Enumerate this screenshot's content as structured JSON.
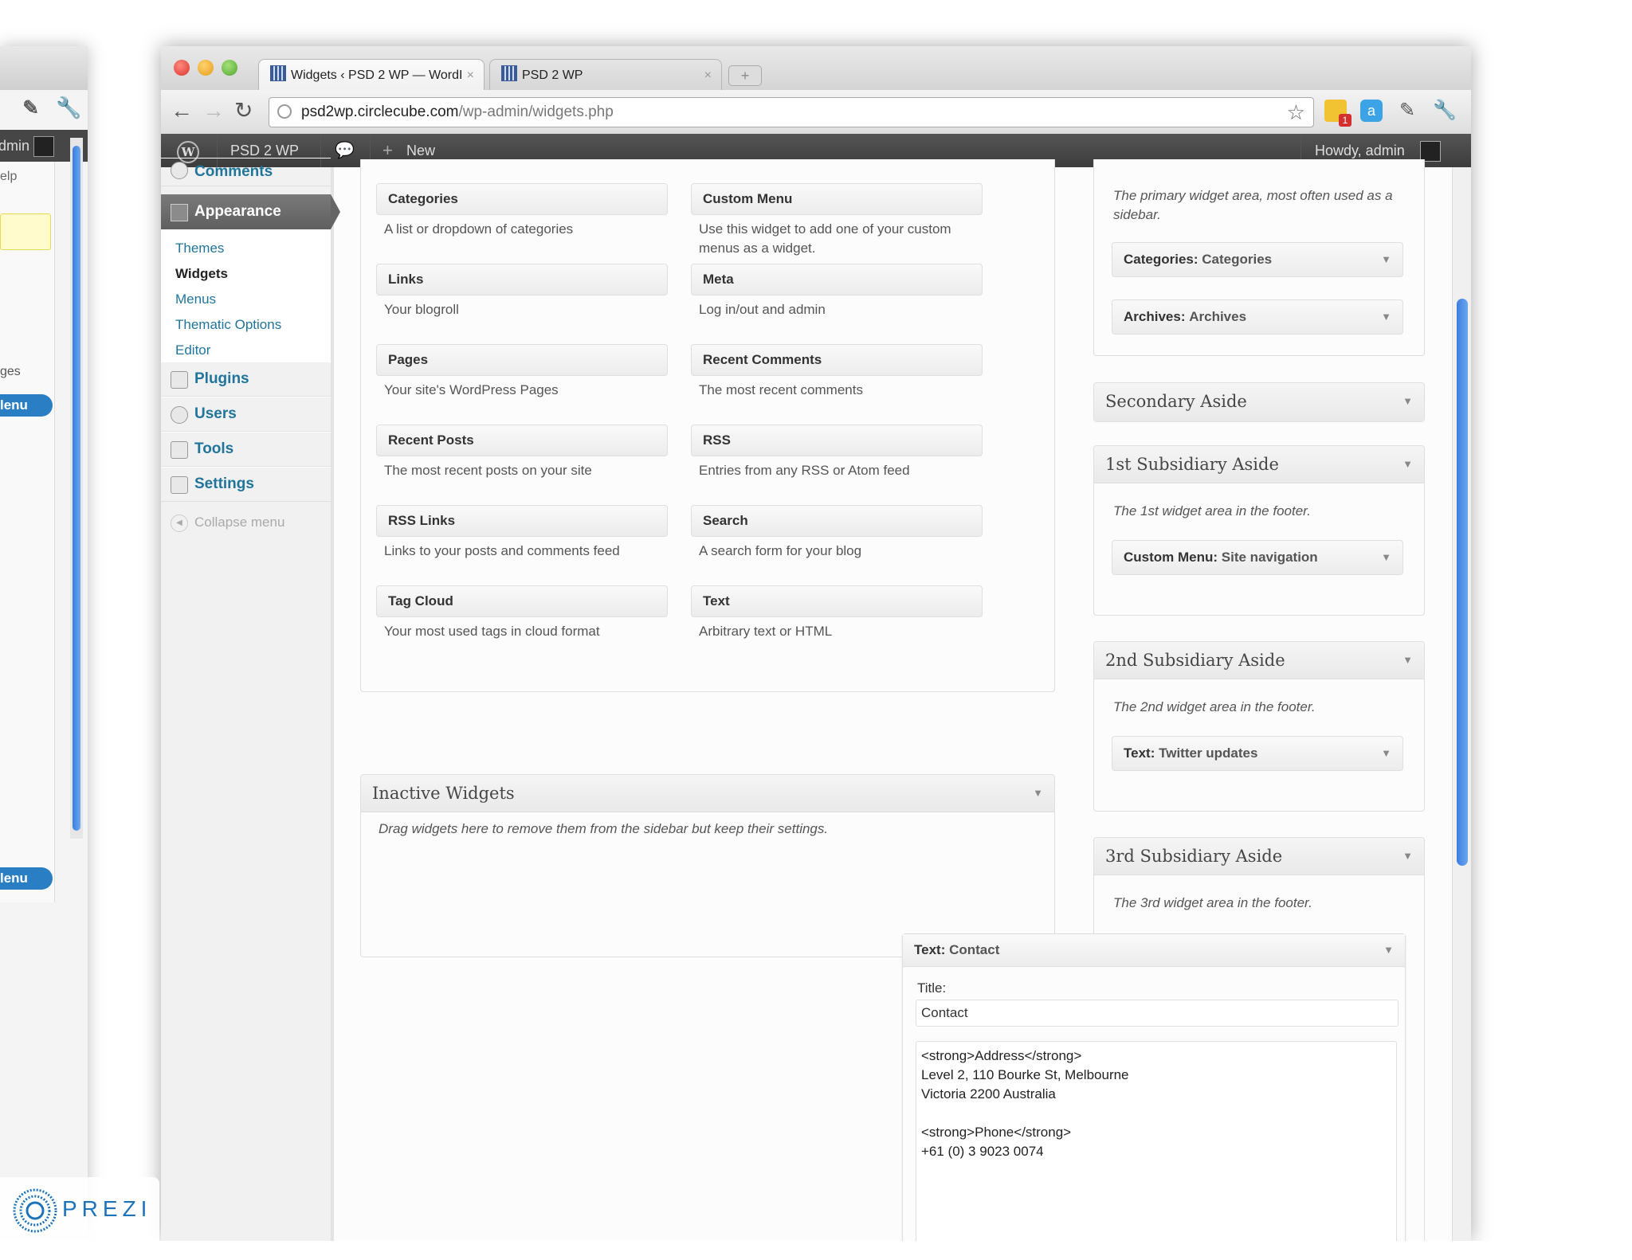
{
  "background_window": {
    "admin_fragment": "dmin",
    "help_fragment": "elp",
    "pages_fragment": "ges",
    "menu_pill_1": "lenu",
    "menu_pill_2": "lenu"
  },
  "browser": {
    "tabs": [
      {
        "label": "Widgets ‹ PSD 2 WP — WordI",
        "close": "×"
      },
      {
        "label": "PSD 2 WP",
        "close": "×"
      }
    ],
    "new_tab": "+",
    "url_domain": "psd2wp.circlecube.com",
    "url_path": "/wp-admin/widgets.php",
    "extension_badge": "1"
  },
  "admin_bar": {
    "site_name": "PSD 2 WP",
    "new_label": "New",
    "howdy": "Howdy, admin"
  },
  "sidebar": {
    "comments": "Comments",
    "appearance": "Appearance",
    "appearance_sub": [
      "Themes",
      "Widgets",
      "Menus",
      "Thematic Options",
      "Editor"
    ],
    "plugins": "Plugins",
    "users": "Users",
    "tools": "Tools",
    "settings": "Settings",
    "collapse": "Collapse menu"
  },
  "available_widgets": [
    {
      "title": "Categories",
      "desc": "A list or dropdown of categories"
    },
    {
      "title": "Custom Menu",
      "desc": "Use this widget to add one of your custom menus as a widget."
    },
    {
      "title": "Links",
      "desc": "Your blogroll"
    },
    {
      "title": "Meta",
      "desc": "Log in/out and admin"
    },
    {
      "title": "Pages",
      "desc": "Your site's WordPress Pages"
    },
    {
      "title": "Recent Comments",
      "desc": "The most recent comments"
    },
    {
      "title": "Recent Posts",
      "desc": "The most recent posts on your site"
    },
    {
      "title": "RSS",
      "desc": "Entries from any RSS or Atom feed"
    },
    {
      "title": "RSS Links",
      "desc": "Links to your posts and comments feed"
    },
    {
      "title": "Search",
      "desc": "A search form for your blog"
    },
    {
      "title": "Tag Cloud",
      "desc": "Your most used tags in cloud format"
    },
    {
      "title": "Text",
      "desc": "Arbitrary text or HTML"
    }
  ],
  "inactive": {
    "title": "Inactive Widgets",
    "desc": "Drag widgets here to remove them from the sidebar but keep their settings."
  },
  "primary_aside": {
    "desc": "The primary widget area, most often used as a sidebar.",
    "widgets": [
      {
        "type": "Categories:",
        "name": "Categories"
      },
      {
        "type": "Archives:",
        "name": "Archives"
      }
    ]
  },
  "secondary_aside": {
    "title": "Secondary Aside"
  },
  "subsidiary_1": {
    "title": "1st Subsidiary Aside",
    "desc": "The 1st widget area in the footer.",
    "widget": {
      "type": "Custom Menu:",
      "name": "Site navigation"
    }
  },
  "subsidiary_2": {
    "title": "2nd Subsidiary Aside",
    "desc": "The 2nd widget area in the footer.",
    "widget": {
      "type": "Text:",
      "name": "Twitter updates"
    }
  },
  "subsidiary_3": {
    "title": "3rd Subsidiary Aside",
    "desc": "The 3rd widget area in the footer."
  },
  "text_widget": {
    "type": "Text:",
    "name": "Contact",
    "title_label": "Title:",
    "title_value": "Contact",
    "body_lines": [
      "<strong>Address</strong>",
      "Level 2, 110 Bourke St, Melbourne",
      "Victoria 2200 Australia",
      "",
      "<strong>Phone</strong>",
      "+61 (0) 3 9023 0074"
    ]
  },
  "prezi": {
    "label": "PREZI"
  },
  "colors": {
    "wp_link": "#21759b",
    "admin_bar": "#464646",
    "scroll_thumb": "#3b7de0"
  }
}
